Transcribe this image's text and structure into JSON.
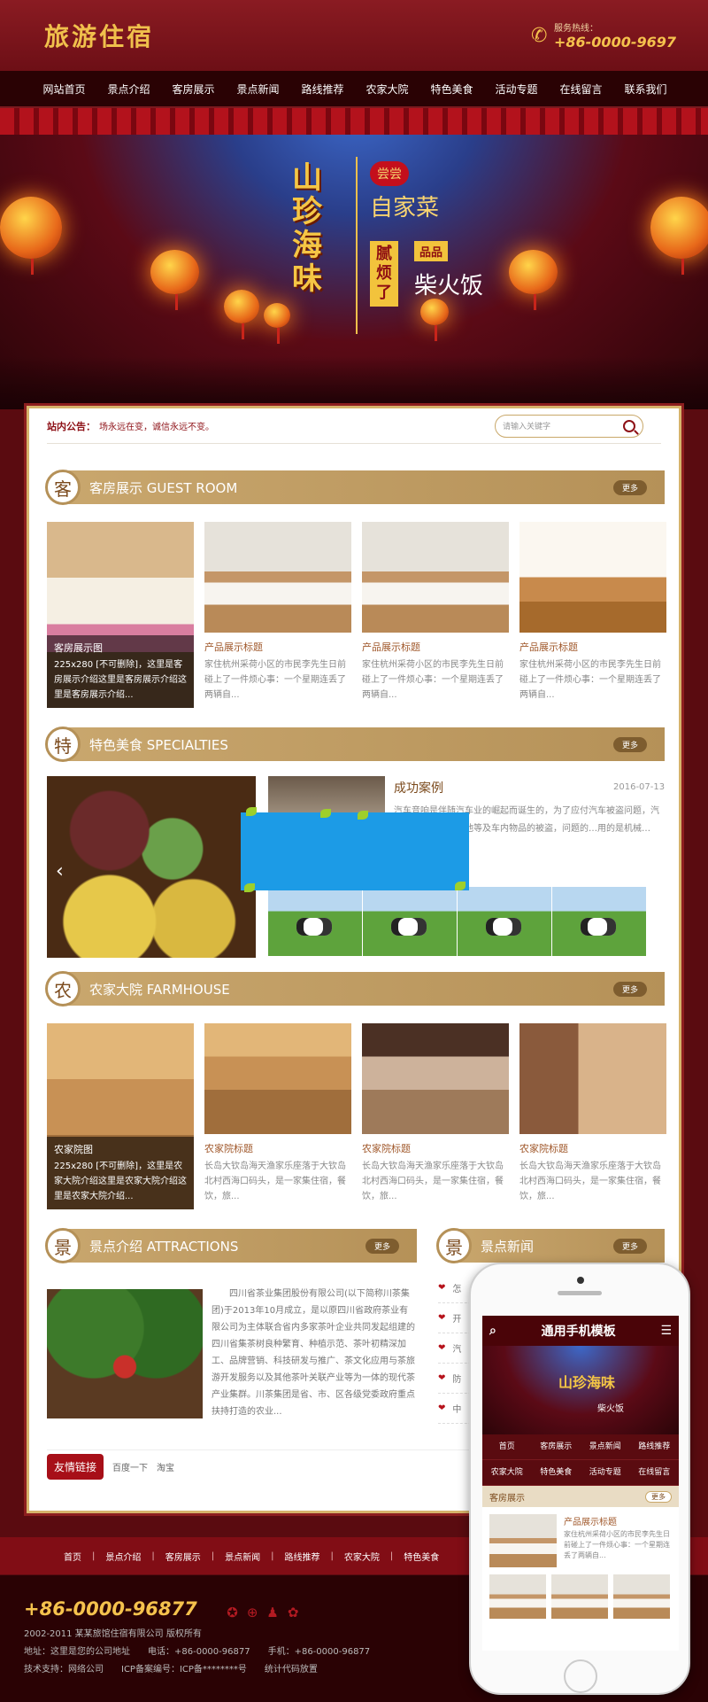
{
  "header": {
    "logo": "旅游住宿",
    "hotline_label": "服务热线：",
    "hotline": "+86-0000-9697"
  },
  "nav": [
    "网站首页",
    "景点介绍",
    "客房展示",
    "景点新闻",
    "路线推荐",
    "农家大院",
    "特色美食",
    "活动专题",
    "在线留言",
    "联系我们"
  ],
  "banner": {
    "t1": "山珍海味",
    "t2": "尝尝",
    "t3": "自家菜",
    "t4": "腻烦了",
    "t5": "品品",
    "t6": "柴火饭"
  },
  "notice": {
    "tag": "站内公告：",
    "text": "场永远在变，诚信永远不变。",
    "search_placeholder": "请输入关键字"
  },
  "rooms": {
    "icon": "客",
    "title": "客房展示 GUEST ROOM",
    "more": "更多",
    "featured": {
      "title": "客房展示图",
      "desc": "225x280 [不可删除]，这里是客房展示介绍这里是客房展示介绍这里是客房展示介绍..."
    },
    "items": [
      {
        "title": "产品展示标题",
        "desc": "家住杭州采荷小区的市民李先生日前碰上了一件烦心事：一个星期连丢了两辆自..."
      },
      {
        "title": "产品展示标题",
        "desc": "家住杭州采荷小区的市民李先生日前碰上了一件烦心事：一个星期连丢了两辆自..."
      },
      {
        "title": "产品展示标题",
        "desc": "家住杭州采荷小区的市民李先生日前碰上了一件烦心事：一个星期连丢了两辆自..."
      }
    ]
  },
  "food": {
    "icon": "特",
    "title": "特色美食 SPECIALTIES",
    "more": "更多",
    "case_title": "成功案例",
    "case_date": "2016-07-13",
    "case_desc": "汽车音响是伴随汽车业的崛起而诞生的，为了应付汽车被盗问题，汽车音响轮胎、蓄电池等及车内物品的被盗，问题的…用的是机械…"
  },
  "farm": {
    "icon": "农",
    "title": "农家大院 FARMHOUSE",
    "more": "更多",
    "featured": {
      "title": "农家院图",
      "desc": "225x280 [不可删除]，这里是农家大院介绍这里是农家大院介绍这里是农家大院介绍..."
    },
    "items": [
      {
        "title": "农家院标题",
        "desc": "长岛大钦岛海天渔家乐座落于大钦岛北村西海口码头，是一家集住宿，餐饮，旅..."
      },
      {
        "title": "农家院标题",
        "desc": "长岛大钦岛海天渔家乐座落于大钦岛北村西海口码头，是一家集住宿，餐饮，旅..."
      },
      {
        "title": "农家院标题",
        "desc": "长岛大钦岛海天渔家乐座落于大钦岛北村西海口码头，是一家集住宿，餐饮，旅..."
      }
    ]
  },
  "attractions": {
    "icon": "景",
    "title": "景点介绍 ATTRACTIONS",
    "more": "更多",
    "text": "四川省茶业集团股份有限公司(以下简称川茶集团)于2013年10月成立，是以原四川省政府茶业有限公司为主体联合省内多家茶叶企业共同发起组建的四川省集茶树良种繁育、种植示范、茶叶初精深加工、品牌营销、科技研发与推广、茶文化应用与茶旅游开发服务以及其他茶叶关联产业等为一体的现代茶产业集群。川茶集团是省、市、区各级党委政府重点扶持打造的农业..."
  },
  "news": {
    "icon": "景",
    "title": "景点新闻",
    "more": "更多",
    "items": [
      "怎",
      "开",
      "汽",
      "防",
      "中"
    ]
  },
  "links": {
    "title": "友情链接",
    "items": [
      "百度一下",
      "淘宝"
    ]
  },
  "footer_nav": [
    "首页",
    "景点介绍",
    "客房展示",
    "景点新闻",
    "路线推荐",
    "农家大院",
    "特色美食"
  ],
  "footer": {
    "tel": "+86-0000-96877",
    "copyright": "2002-2011 某某旅馆住宿有限公司 版权所有",
    "address": "地址：这里是您的公司地址　　电话：+86-0000-96877　　手机：+86-0000-96877",
    "support": "技术支持：网络公司　　ICP备案编号：ICP备********号　　统计代码放置"
  },
  "mobile": {
    "title": "通用手机模板",
    "banner_slogan": "山珍海味",
    "banner_sub": "柴火饭",
    "nav": [
      "首页",
      "客房展示",
      "景点新闻",
      "路线推荐",
      "农家大院",
      "特色美食",
      "活动专题",
      "在线留言"
    ],
    "sec_title": "客房展示",
    "more": "更多",
    "item_title": "产品展示标题",
    "item_desc": "家住杭州采荷小区的市民李先生日前碰上了一件烦心事：一个星期连丢了两辆自..."
  }
}
